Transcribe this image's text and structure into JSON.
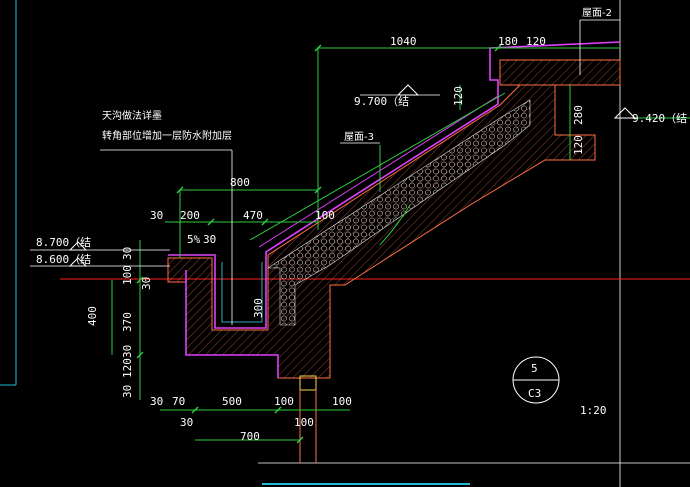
{
  "labels": {
    "roof2": "屋面-2",
    "roof3": "屋面-3",
    "note_line1": "天沟做法详墨",
    "note_line2": "转角部位增加一层防水附加层",
    "slope": "5%",
    "detail_number": "5",
    "detail_sheet": "C3",
    "scale": "1:20"
  },
  "elevations": {
    "e9700": "9.700（结",
    "e9420": "9.420（结",
    "e8700": "8.700（结",
    "e8600": "8.600（结"
  },
  "dimensions": {
    "d1040": "1040",
    "d180": "180",
    "d120_top": "120",
    "d120_left": "120",
    "d280": "280",
    "d120_right": "120",
    "d800": "800",
    "d30_a": "30",
    "d200": "200",
    "d470": "470",
    "d100_a": "100",
    "d30_b": "30",
    "d30_c": "30",
    "d100_v": "100",
    "d30_v": "30",
    "d400": "400",
    "d370": "370",
    "d300": "300",
    "d30_v2": "30",
    "d120_v": "120",
    "d30_v3": "30",
    "d30_d": "30",
    "d70": "70",
    "d500": "500",
    "d100_b": "100",
    "d100_c": "100",
    "d30_e": "30",
    "d100_d": "100",
    "d700": "700"
  },
  "colors": {
    "background": "#000000",
    "dimension": "#2ecc40",
    "text": "#ffffff",
    "waterproof": "#e040fb",
    "concrete": "#ff7043",
    "red_line": "#ff2020",
    "insulation": "#e0e0e0",
    "cyan": "#44d7e8"
  }
}
